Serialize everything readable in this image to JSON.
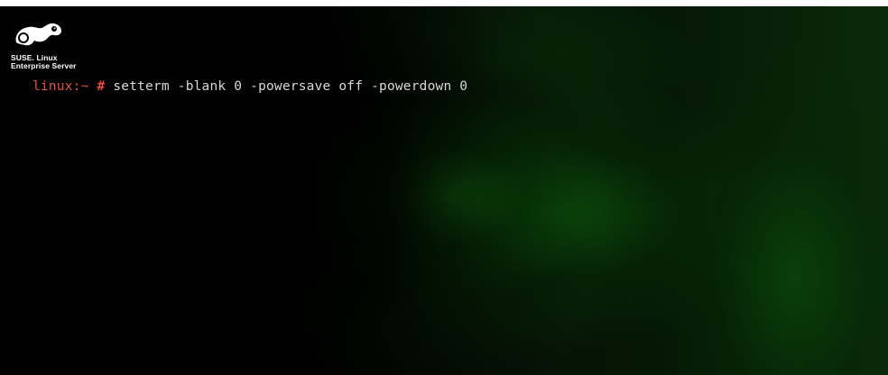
{
  "logo": {
    "icon": "suse-chameleon-icon",
    "line1": "SUSE. Linux",
    "line2": "Enterprise Server"
  },
  "console": {
    "prompt": "linux:~",
    "hash": "#",
    "command": "setterm -blank 0 -powersave off -powerdown 0"
  },
  "colors": {
    "prompt": "#e84c44",
    "command": "#d8d8d8",
    "background": "#000000",
    "glow": "#148214"
  }
}
